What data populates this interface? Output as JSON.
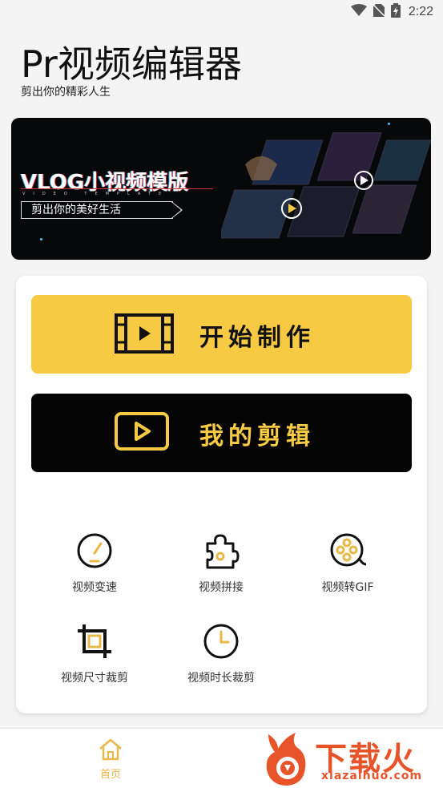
{
  "status_bar": {
    "time": "2:22",
    "icons": [
      "wifi-icon",
      "no-sim-icon",
      "battery-charging-icon"
    ]
  },
  "header": {
    "title": "Pr视频编辑器",
    "subtitle": "剪出你的精彩人生"
  },
  "banner": {
    "title": "VLOG小视频模版",
    "english": "VIDEO TEMPLATE",
    "slogan": "剪出你的美好生活"
  },
  "actions": {
    "start_label": "开始制作",
    "start_icon": "film-play-icon",
    "my_label": "我的剪辑",
    "my_icon": "play-box-icon"
  },
  "tools": [
    {
      "label": "视频变速",
      "icon": "speedometer-icon"
    },
    {
      "label": "视频拼接",
      "icon": "puzzle-icon"
    },
    {
      "label": "视频转GIF",
      "icon": "film-reel-icon"
    },
    {
      "label": "视频尺寸裁剪",
      "icon": "crop-icon"
    },
    {
      "label": "视频时长裁剪",
      "icon": "clock-icon"
    }
  ],
  "bottom_nav": {
    "home_label": "首页",
    "home_icon": "home-icon"
  },
  "watermark": {
    "text": "下载火",
    "url": "xiazaihuo.com"
  },
  "colors": {
    "accent": "#f6ca43",
    "dark": "#050505",
    "watermark": "#e8542a"
  }
}
